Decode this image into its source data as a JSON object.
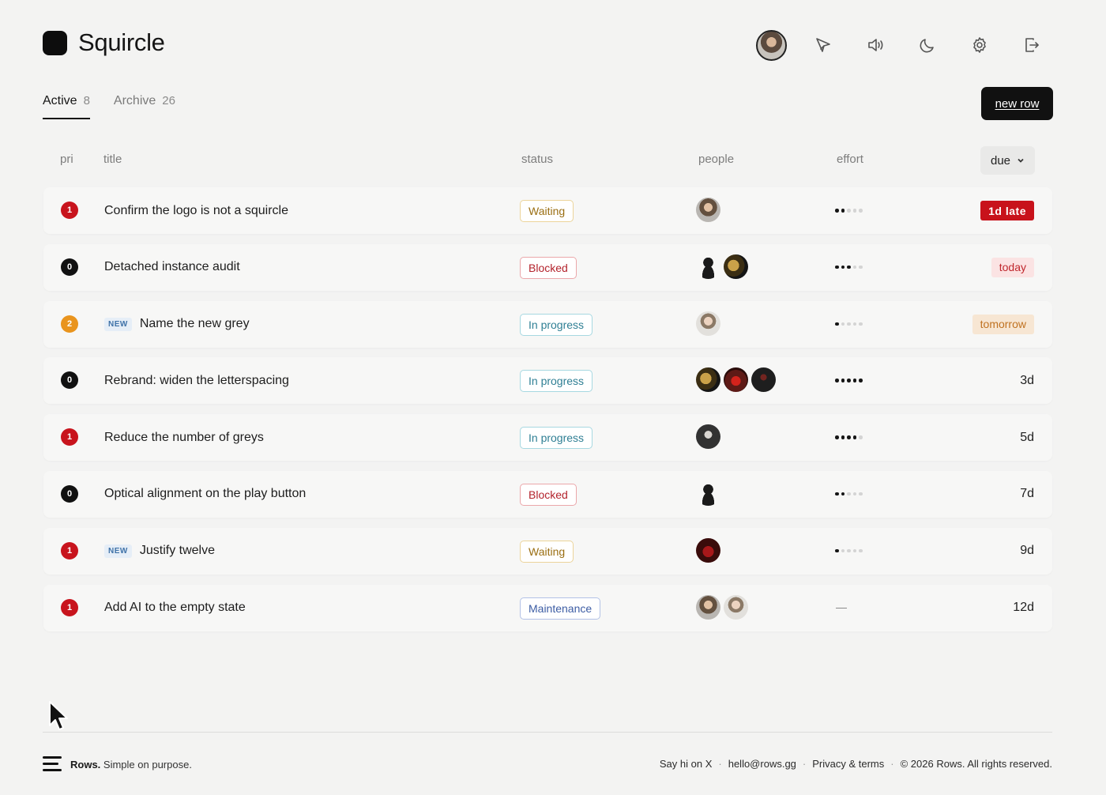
{
  "app": {
    "name": "Squircle"
  },
  "header": {
    "icons": [
      "avatar-icon",
      "send-icon",
      "volume-icon",
      "moon-icon",
      "gear-icon",
      "logout-icon"
    ]
  },
  "tabs": [
    {
      "label": "Active",
      "count": "8"
    },
    {
      "label": "Archive",
      "count": "26"
    }
  ],
  "new_row_label": "new row",
  "columns": {
    "pri": "pri",
    "title": "title",
    "status": "status",
    "people": "people",
    "effort": "effort",
    "due": "due"
  },
  "rows": [
    {
      "pri": "1",
      "is_new": false,
      "title": "Confirm the logo is not a squircle",
      "status": "Waiting",
      "people": [
        "a1"
      ],
      "effort": 2,
      "due": "1d late",
      "due_style": "late"
    },
    {
      "pri": "0",
      "is_new": false,
      "title": "Detached instance audit",
      "status": "Blocked",
      "people": [
        "a2",
        "a3"
      ],
      "effort": 3,
      "due": "today",
      "due_style": "today"
    },
    {
      "pri": "2",
      "is_new": true,
      "title": "Name the new grey",
      "status": "In progress",
      "people": [
        "a4"
      ],
      "effort": 1,
      "due": "tomorrow",
      "due_style": "tomorrow"
    },
    {
      "pri": "0",
      "is_new": false,
      "title": "Rebrand: widen the letterspacing",
      "status": "In progress",
      "people": [
        "a3",
        "a5",
        "a6"
      ],
      "effort": 5,
      "due": "3d",
      "due_style": "normal"
    },
    {
      "pri": "1",
      "is_new": false,
      "title": "Reduce the number of greys",
      "status": "In progress",
      "people": [
        "a7"
      ],
      "effort": 4,
      "due": "5d",
      "due_style": "normal"
    },
    {
      "pri": "0",
      "is_new": false,
      "title": "Optical alignment on the play button",
      "status": "Blocked",
      "people": [
        "a2"
      ],
      "effort": 2,
      "due": "7d",
      "due_style": "normal"
    },
    {
      "pri": "1",
      "is_new": true,
      "title": "Justify twelve",
      "status": "Waiting",
      "people": [
        "a8"
      ],
      "effort": 1,
      "due": "9d",
      "due_style": "normal"
    },
    {
      "pri": "1",
      "is_new": false,
      "title": "Add AI to the empty state",
      "status": "Maintenance",
      "people": [
        "a1",
        "a4"
      ],
      "effort": 0,
      "due": "12d",
      "due_style": "normal"
    }
  ],
  "new_badge": "NEW",
  "effort_max": 5,
  "footer": {
    "brand": "Rows.",
    "tagline": "Simple on purpose.",
    "links": [
      "Say hi on X",
      "hello@rows.gg",
      "Privacy & terms",
      "© 2026 Rows. All rights reserved."
    ]
  },
  "colors": {
    "accent": "#111111",
    "late": "#c8121b",
    "background": "#f3f3f2"
  }
}
